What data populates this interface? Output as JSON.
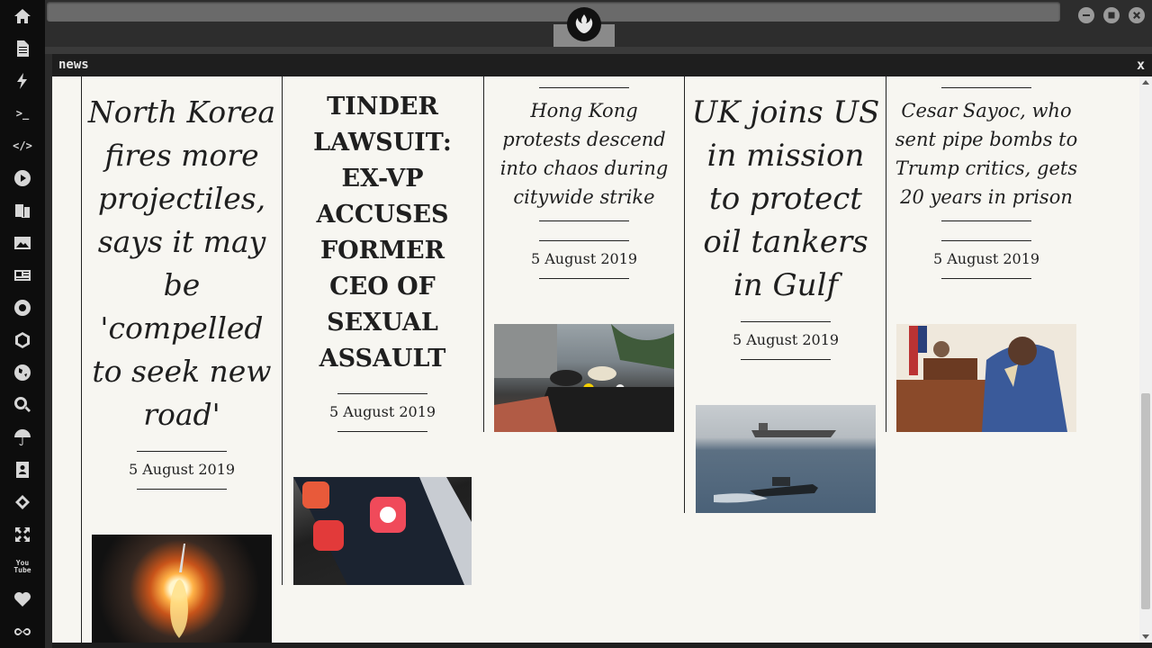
{
  "window": {
    "title": "news",
    "close": "x"
  },
  "articles": [
    {
      "headline": "North Korea fires more projectiles, says it may be 'compelled to seek new road'",
      "date": "5 August 2019",
      "image": "missile-launch-photo"
    },
    {
      "headline": "TINDER LAWSUIT: EX-VP ACCUSES FORMER CEO OF SEXUAL ASSAULT",
      "date": "5 August 2019",
      "image": "tinder-app-phone-photo"
    },
    {
      "headline": "Hong Kong protests descend into chaos during citywide strike",
      "date": "5 August 2019",
      "image": "hong-kong-protest-photo"
    },
    {
      "headline": "UK joins US in mission to protect oil tankers in Gulf",
      "date": "5 August 2019",
      "image": "oil-tanker-gulf-photo"
    },
    {
      "headline": "Cesar Sayoc, who sent pipe bombs to Trump critics, gets 20 years in prison",
      "date": "5 August 2019",
      "image": "courtroom-sketch"
    }
  ],
  "dock": {
    "icons": [
      "home-icon",
      "document-icon",
      "lightning-icon",
      "terminal-icon",
      "code-icon",
      "play-icon",
      "translate-icon",
      "image-icon",
      "newspaper-icon",
      "rebel-icon",
      "hexagon-icon",
      "globe-icon",
      "search-icon",
      "umbrella-icon",
      "contacts-icon",
      "diamond-code-icon",
      "expand-icon",
      "youtube-icon",
      "heart-icon",
      "infinity-icon"
    ],
    "terminal_label": ">_",
    "code_label": "</>",
    "youtube_label": "You Tube"
  }
}
